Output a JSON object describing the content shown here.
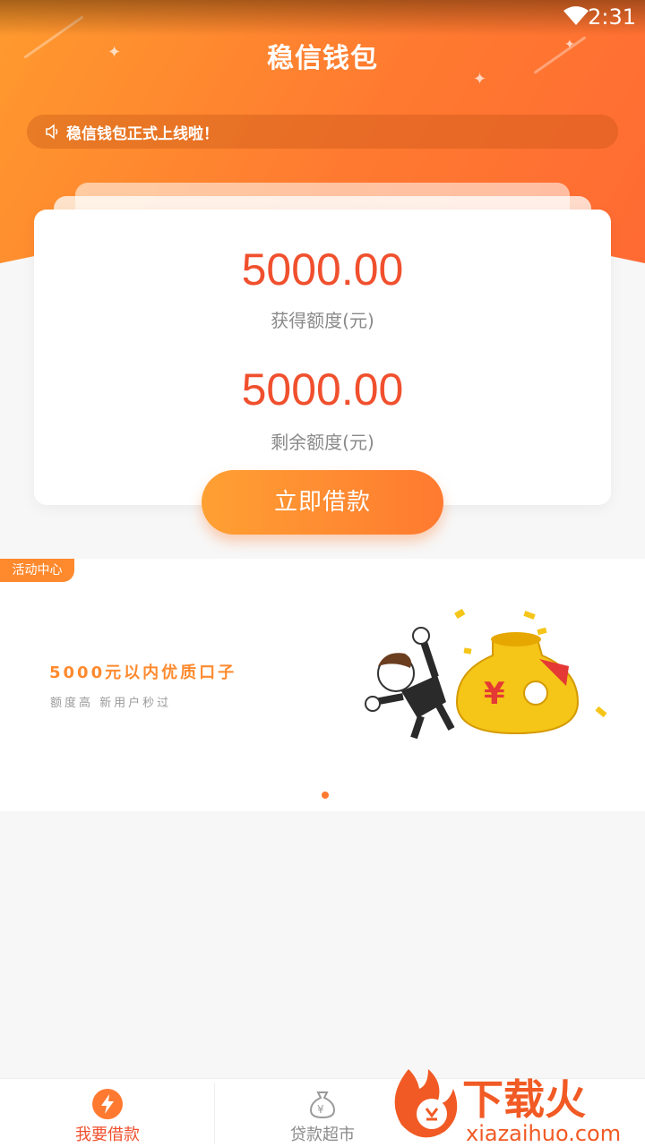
{
  "status_bar": {
    "time": "2:31",
    "wifi_icon": "wifi-icon"
  },
  "header": {
    "title": "稳信钱包"
  },
  "notice": {
    "text": "稳信钱包正式上线啦！",
    "icon": "speaker-icon"
  },
  "quota": {
    "obtained_amount": "5000.00",
    "obtained_label": "获得额度(元)",
    "remaining_amount": "5000.00",
    "remaining_label": "剩余额度(元)"
  },
  "borrow_button": {
    "label": "立即借款"
  },
  "banner": {
    "tag": "活动中心",
    "title": "5000元以内优质口子",
    "subtitle": "额度高 新用户秒过",
    "illustration": "businessman-money-bag-illustration",
    "page_indicator": {
      "current": 1,
      "total": 1
    }
  },
  "tabs": [
    {
      "label": "我要借款",
      "icon": "lightning-icon",
      "active": true
    },
    {
      "label": "贷款超市",
      "icon": "money-bag-icon",
      "active": false
    }
  ],
  "watermark": {
    "brand": "下载火",
    "url": "xiazaihuo.com"
  },
  "colors": {
    "accent": "#ff7a30",
    "amount": "#f0502e",
    "tab_active": "#f0502e",
    "tab_inactive": "#8a8a8a"
  }
}
